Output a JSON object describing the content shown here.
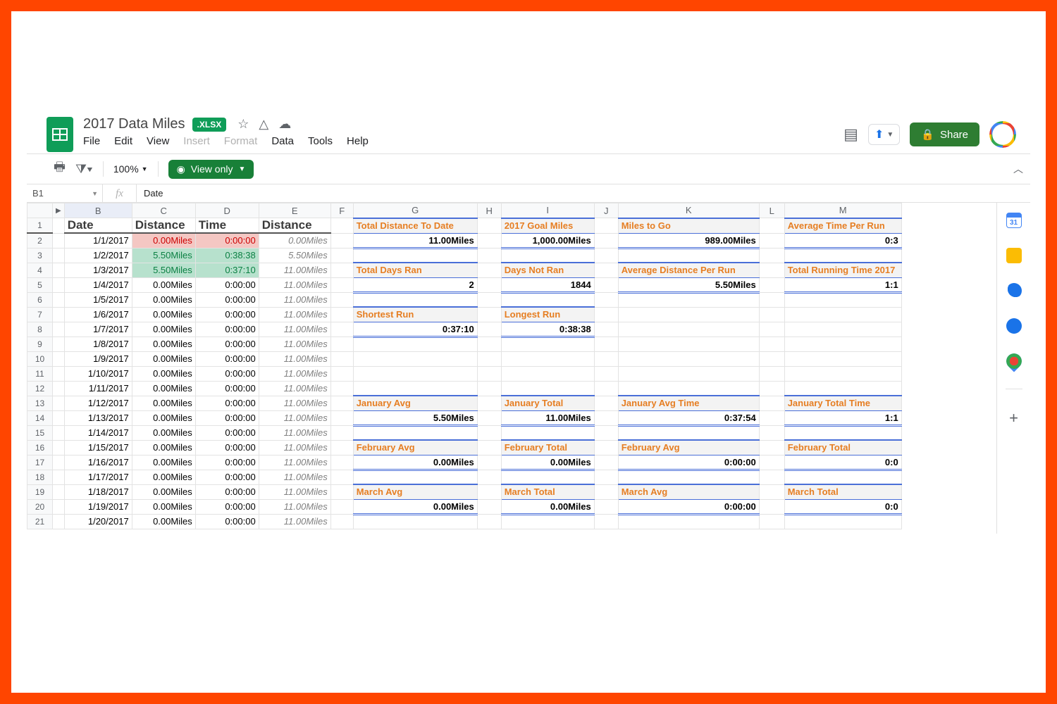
{
  "header": {
    "title": "2017 Data Miles",
    "badge": ".XLSX",
    "share": "Share"
  },
  "menus": [
    "File",
    "Edit",
    "View",
    "Insert",
    "Format",
    "Data",
    "Tools",
    "Help"
  ],
  "menus_disabled": [
    3,
    4
  ],
  "toolbar": {
    "zoom": "100%",
    "mode": "View only"
  },
  "namebox": {
    "ref": "B1",
    "value": "Date"
  },
  "columns": [
    "",
    "B",
    "C",
    "D",
    "E",
    "F",
    "G",
    "H",
    "I",
    "J",
    "K",
    "L",
    "M"
  ],
  "table_headers": {
    "B": "Date",
    "C": "Distance",
    "D": "Time",
    "E": "Distance"
  },
  "rows": [
    {
      "n": 2,
      "date": "1/1/2017",
      "dist": "0.00Miles",
      "time": "0:00:00",
      "cum": "0.00Miles",
      "hl": "red"
    },
    {
      "n": 3,
      "date": "1/2/2017",
      "dist": "5.50Miles",
      "time": "0:38:38",
      "cum": "5.50Miles",
      "hl": "grn"
    },
    {
      "n": 4,
      "date": "1/3/2017",
      "dist": "5.50Miles",
      "time": "0:37:10",
      "cum": "11.00Miles",
      "hl": "grn"
    },
    {
      "n": 5,
      "date": "1/4/2017",
      "dist": "0.00Miles",
      "time": "0:00:00",
      "cum": "11.00Miles"
    },
    {
      "n": 6,
      "date": "1/5/2017",
      "dist": "0.00Miles",
      "time": "0:00:00",
      "cum": "11.00Miles"
    },
    {
      "n": 7,
      "date": "1/6/2017",
      "dist": "0.00Miles",
      "time": "0:00:00",
      "cum": "11.00Miles"
    },
    {
      "n": 8,
      "date": "1/7/2017",
      "dist": "0.00Miles",
      "time": "0:00:00",
      "cum": "11.00Miles"
    },
    {
      "n": 9,
      "date": "1/8/2017",
      "dist": "0.00Miles",
      "time": "0:00:00",
      "cum": "11.00Miles"
    },
    {
      "n": 10,
      "date": "1/9/2017",
      "dist": "0.00Miles",
      "time": "0:00:00",
      "cum": "11.00Miles"
    },
    {
      "n": 11,
      "date": "1/10/2017",
      "dist": "0.00Miles",
      "time": "0:00:00",
      "cum": "11.00Miles"
    },
    {
      "n": 12,
      "date": "1/11/2017",
      "dist": "0.00Miles",
      "time": "0:00:00",
      "cum": "11.00Miles"
    },
    {
      "n": 13,
      "date": "1/12/2017",
      "dist": "0.00Miles",
      "time": "0:00:00",
      "cum": "11.00Miles"
    },
    {
      "n": 14,
      "date": "1/13/2017",
      "dist": "0.00Miles",
      "time": "0:00:00",
      "cum": "11.00Miles"
    },
    {
      "n": 15,
      "date": "1/14/2017",
      "dist": "0.00Miles",
      "time": "0:00:00",
      "cum": "11.00Miles"
    },
    {
      "n": 16,
      "date": "1/15/2017",
      "dist": "0.00Miles",
      "time": "0:00:00",
      "cum": "11.00Miles"
    },
    {
      "n": 17,
      "date": "1/16/2017",
      "dist": "0.00Miles",
      "time": "0:00:00",
      "cum": "11.00Miles"
    },
    {
      "n": 18,
      "date": "1/17/2017",
      "dist": "0.00Miles",
      "time": "0:00:00",
      "cum": "11.00Miles"
    },
    {
      "n": 19,
      "date": "1/18/2017",
      "dist": "0.00Miles",
      "time": "0:00:00",
      "cum": "11.00Miles"
    },
    {
      "n": 20,
      "date": "1/19/2017",
      "dist": "0.00Miles",
      "time": "0:00:00",
      "cum": "11.00Miles"
    },
    {
      "n": 21,
      "date": "1/20/2017",
      "dist": "0.00Miles",
      "time": "0:00:00",
      "cum": "11.00Miles"
    }
  ],
  "stat_groups": [
    {
      "row": 1,
      "cells": [
        {
          "label": "Total Distance To Date",
          "value": "11.00Miles"
        },
        {
          "label": "2017 Goal Miles",
          "value": "1,000.00Miles"
        },
        {
          "label": "Miles to Go",
          "value": "989.00Miles"
        },
        {
          "label": "Average Time Per Run",
          "value": "0:3"
        }
      ]
    },
    {
      "row": 4,
      "cells": [
        {
          "label": "Total Days Ran",
          "value": "2"
        },
        {
          "label": "Days Not Ran",
          "value": "1844"
        },
        {
          "label": "Average Distance Per Run",
          "value": "5.50Miles"
        },
        {
          "label": "Total Running Time 2017",
          "value": "1:1"
        }
      ]
    },
    {
      "row": 7,
      "cells": [
        {
          "label": "Shortest Run",
          "value": "0:37:10"
        },
        {
          "label": "Longest Run",
          "value": "0:38:38"
        }
      ]
    },
    {
      "row": 13,
      "cells": [
        {
          "label": "January Avg",
          "value": "5.50Miles"
        },
        {
          "label": "January Total",
          "value": "11.00Miles"
        },
        {
          "label": "January Avg Time",
          "value": "0:37:54"
        },
        {
          "label": "January Total Time",
          "value": "1:1"
        }
      ]
    },
    {
      "row": 16,
      "cells": [
        {
          "label": "February Avg",
          "value": "0.00Miles"
        },
        {
          "label": "February Total",
          "value": "0.00Miles"
        },
        {
          "label": "February Avg",
          "value": "0:00:00"
        },
        {
          "label": "February Total",
          "value": "0:0"
        }
      ]
    },
    {
      "row": 19,
      "cells": [
        {
          "label": "March Avg",
          "value": "0.00Miles"
        },
        {
          "label": "March Total",
          "value": "0.00Miles"
        },
        {
          "label": "March Avg",
          "value": "0:00:00"
        },
        {
          "label": "March Total",
          "value": "0:0"
        }
      ]
    }
  ]
}
